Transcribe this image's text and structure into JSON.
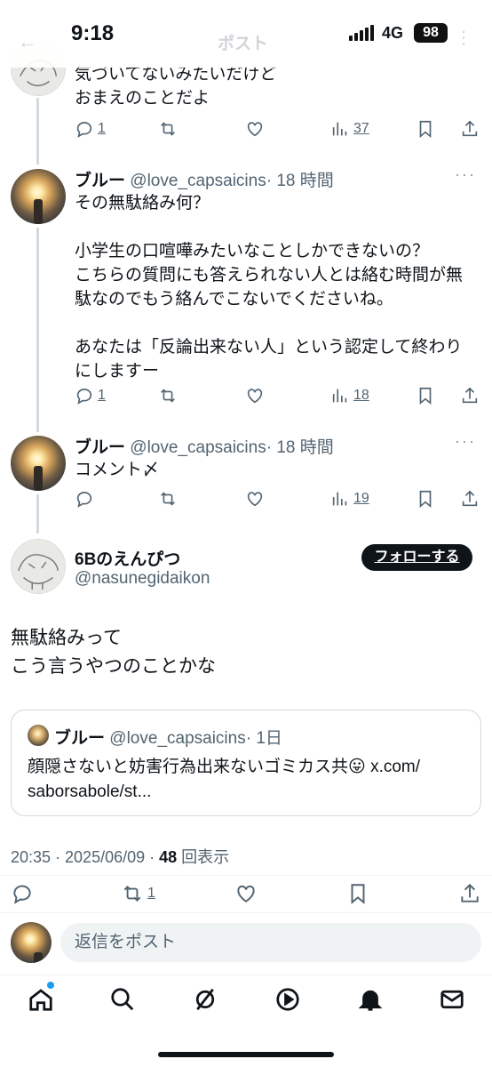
{
  "status_bar": {
    "time": "9:18",
    "network": "4G",
    "battery": "98"
  },
  "nav": {
    "title": "ポスト"
  },
  "posts": [
    {
      "text": "気づいてないみたいだけど\nおまえのことだよ",
      "replies": "1",
      "views": "37"
    },
    {
      "name": "ブルー",
      "handle": "@love_capsaicins",
      "time": "· 18 時間",
      "text": "その無駄絡み何？\n\n小学生の口喧嘩みたいなことしかできないの？\nこちらの質問にも答えられない人とは絡む時間が無\n駄なのでもう絡んでこないでくださいね。\n\nあなたは「反論出来ない人」という認定して終わり\nにしますー",
      "replies": "1",
      "views": "18"
    },
    {
      "name": "ブルー",
      "handle": "@love_capsaicins",
      "time": "· 18 時間",
      "text": "コメント〆",
      "replies": "",
      "views": "19"
    }
  ],
  "main_post": {
    "name": "6Bのえんぴつ",
    "handle": "@nasunegidaikon",
    "follow_label": "フォローする",
    "text": "無駄絡みって\nこう言うやつのことかな",
    "quote": {
      "name": "ブルー",
      "handle": "@love_capsaicins",
      "time": "· 1日",
      "text": "顔隠さないと妨害行為出来ないゴミカス共😛 x.com/\nsaborsabole/st..."
    },
    "timestamp": "20:35 · 2025/06/09 · ",
    "views_count": "48",
    "views_label": " 回表示",
    "reposts": "1"
  },
  "reply_box": {
    "placeholder": "返信をポスト"
  },
  "icons": [
    "reply-icon",
    "repost-icon",
    "like-icon",
    "views-icon",
    "bookmark-icon",
    "share-icon",
    "home-icon",
    "search-icon",
    "grok-icon",
    "video-icon",
    "notifications-icon",
    "messages-icon"
  ]
}
